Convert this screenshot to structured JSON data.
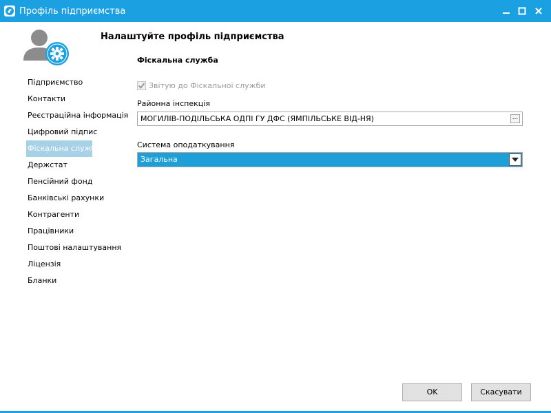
{
  "window": {
    "title": "Профіль підприємства",
    "accent_color": "#1ba1e2",
    "controls": [
      "minimize-icon",
      "maximize-icon",
      "close-icon"
    ]
  },
  "header": {
    "title": "Налаштуйте профіль підприємства",
    "avatar_icon": "user-gear-icon"
  },
  "sidebar": {
    "items": [
      {
        "label": "Підприємство"
      },
      {
        "label": "Контакти"
      },
      {
        "label": "Реєстраційна інформація"
      },
      {
        "label": "Цифровий підпис"
      },
      {
        "label": "Фіскальна служба",
        "active": true
      },
      {
        "label": "Держстат"
      },
      {
        "label": "Пенсійний фонд"
      },
      {
        "label": "Банківські рахунки"
      },
      {
        "label": "Контрагенти"
      },
      {
        "label": "Працівники"
      },
      {
        "label": "Поштові налаштування"
      },
      {
        "label": "Ліцензія"
      },
      {
        "label": "Бланки"
      }
    ]
  },
  "main": {
    "section_title": "Фіскальна служба",
    "report_checkbox": {
      "label": "Звітую до Фіскальної служби",
      "checked": true,
      "disabled": true
    },
    "inspection": {
      "label": "Районна інспекція",
      "value": "МОГИЛІВ-ПОДІЛЬСЬКА ОДПІ  ГУ ДФС (ЯМПІЛЬСЬКЕ ВІД-НЯ)",
      "browse_label": "..."
    },
    "tax_system": {
      "label": "Система оподаткування",
      "selected": "Загальна",
      "highlight_color": "#1e9fd8"
    }
  },
  "buttons": {
    "ok": "OK",
    "cancel": "Скасувати"
  }
}
